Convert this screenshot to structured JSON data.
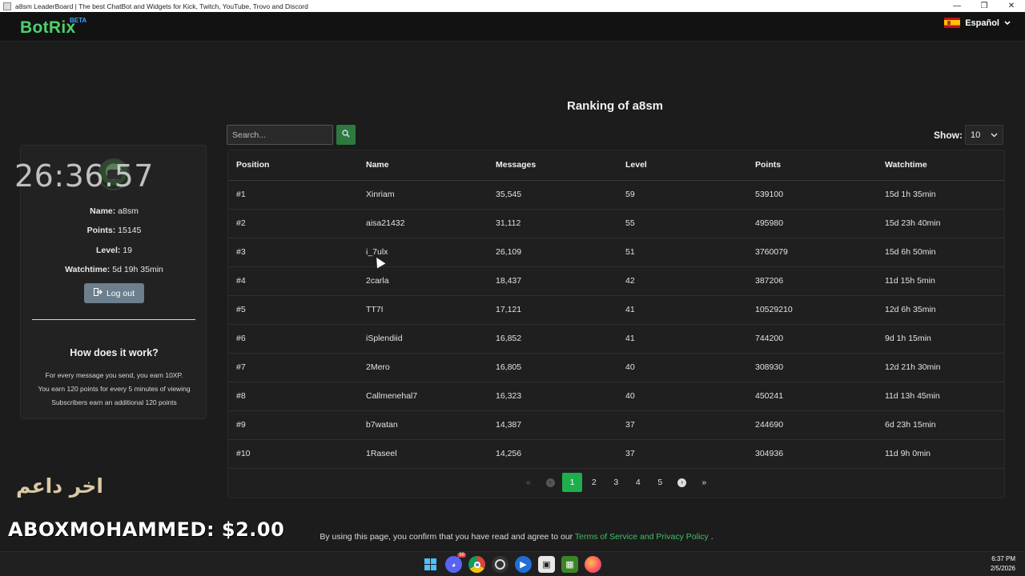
{
  "window": {
    "title": "a8sm LeaderBoard | The best ChatBot and Widgets for Kick, Twitch, YouTube, Trovo and Discord",
    "minimize": "—",
    "maximize": "❐",
    "close": "✕"
  },
  "navbar": {
    "logo": "BotRix",
    "logo_badge": "BETA",
    "language": "Español",
    "colors": {
      "brand": "#4fd06b",
      "badge": "#3ea5ff"
    }
  },
  "page_title": "Ranking of a8sm",
  "profile": {
    "name_label": "Name:",
    "name": "a8sm",
    "points_label": "Points:",
    "points": "15145",
    "level_label": "Level:",
    "level": "19",
    "watchtime_label": "Watchtime:",
    "watchtime": "5d 19h 35min",
    "logout": "Log out"
  },
  "how": {
    "title": "How does it work?",
    "lines": [
      "For every message you send, you earn 10XP.",
      "You earn 120 points for every 5 minutes of viewing",
      "Subscribers earn an additional 120 points"
    ]
  },
  "search": {
    "placeholder": "Search..."
  },
  "show": {
    "label": "Show:",
    "value": "10"
  },
  "table": {
    "headers": [
      "Position",
      "Name",
      "Messages",
      "Level",
      "Points",
      "Watchtime"
    ],
    "rows": [
      [
        "#1",
        "Xinriam",
        "35,545",
        "59",
        "539100",
        "15d 1h 35min"
      ],
      [
        "#2",
        "aisa21432",
        "31,112",
        "55",
        "495980",
        "15d 23h 40min"
      ],
      [
        "#3",
        "i_7ulx",
        "26,109",
        "51",
        "3760079",
        "15d 6h 50min"
      ],
      [
        "#4",
        "2carla",
        "18,437",
        "42",
        "387206",
        "11d 15h 5min"
      ],
      [
        "#5",
        "TT7I",
        "17,121",
        "41",
        "10529210",
        "12d 6h 35min"
      ],
      [
        "#6",
        "iSplendiid",
        "16,852",
        "41",
        "744200",
        "9d 1h 15min"
      ],
      [
        "#7",
        "2Mero",
        "16,805",
        "40",
        "308930",
        "12d 21h 30min"
      ],
      [
        "#8",
        "Callmenehal7",
        "16,323",
        "40",
        "450241",
        "11d 13h 45min"
      ],
      [
        "#9",
        "b7watan",
        "14,387",
        "37",
        "244690",
        "6d 23h 15min"
      ],
      [
        "#10",
        "1Raseel",
        "14,256",
        "37",
        "304936",
        "11d 9h 0min"
      ]
    ]
  },
  "pagination": {
    "first": "«",
    "prev": "‹",
    "pages": [
      "1",
      "2",
      "3",
      "4",
      "5"
    ],
    "active": "1",
    "next": "›",
    "last": "»"
  },
  "footer": {
    "text_before": "By using this page, you confirm that you have read and agree to our",
    "link": "Terms of Service and Privacy Policy",
    "text_after": "."
  },
  "overlay": {
    "timer": "26:36.57",
    "arabic": "اخر داعم",
    "donation": "ABOXMOHAMMED: $2.00"
  },
  "taskbar": {
    "time": "6:37 PM",
    "date": "2/5/2026",
    "discord_badge": "99"
  }
}
